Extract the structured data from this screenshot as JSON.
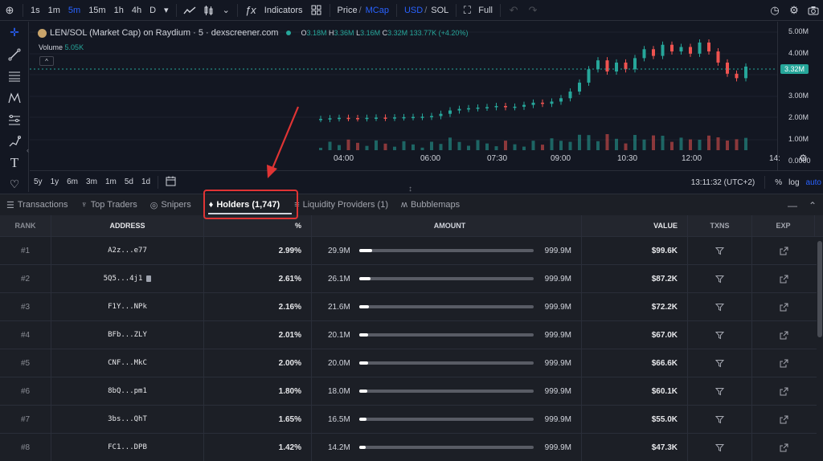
{
  "toolbar": {
    "intervals": [
      "1s",
      "1m",
      "5m",
      "15m",
      "1h",
      "4h",
      "D"
    ],
    "active_interval": "5m",
    "indicators_label": "Indicators",
    "price_label": "Price",
    "mcap_label": "MCap",
    "usd_label": "USD",
    "sol_label": "SOL",
    "full_label": "Full"
  },
  "chart": {
    "title": "LEN/SOL (Market Cap) on Raydium · 5 · dexscreener.com",
    "ohlc": {
      "o_label": "O",
      "o": "3.18M",
      "h_label": "H",
      "h": "3.36M",
      "l_label": "L",
      "l": "3.16M",
      "c_label": "C",
      "c": "3.32M",
      "change": "133.77K (+4.20%)"
    },
    "volume_label": "Volume",
    "volume_value": "5.05K",
    "y_ticks": [
      "5.00M",
      "4.00M",
      "3.00M",
      "2.00M",
      "1.00M",
      "0.0000"
    ],
    "current_price": "3.32M",
    "x_ticks": [
      "04:00",
      "06:00",
      "07:30",
      "09:00",
      "10:30",
      "12:00",
      "14:"
    ],
    "ranges": [
      "5y",
      "1y",
      "6m",
      "3m",
      "1m",
      "5d",
      "1d"
    ],
    "clock": "13:11:32 (UTC+2)",
    "pct_label": "%",
    "log_label": "log",
    "auto_label": "auto",
    "colors": {
      "up": "#26a69a",
      "down": "#ef5350",
      "accent": "#2962ff"
    }
  },
  "chart_data": {
    "type": "candlestick",
    "title": "LEN/SOL (Market Cap) on Raydium · 5 · dexscreener.com",
    "x_ticks": [
      "04:00",
      "06:00",
      "07:30",
      "09:00",
      "10:30",
      "12:00",
      "14:"
    ],
    "y_ticks": [
      "5.00M",
      "4.00M",
      "3.00M",
      "2.00M",
      "1.00M",
      "0.0000"
    ],
    "ylim": [
      0,
      5000000
    ],
    "close_series_approx": [
      [
        0.14,
        0.97
      ],
      [
        0.16,
        1.0
      ],
      [
        0.18,
        1.02
      ],
      [
        0.2,
        1.01
      ],
      [
        0.22,
        1.0
      ],
      [
        0.24,
        1.02
      ],
      [
        0.26,
        1.03
      ],
      [
        0.28,
        1.02
      ],
      [
        0.3,
        1.04
      ],
      [
        0.32,
        1.05
      ],
      [
        0.34,
        1.06
      ],
      [
        0.36,
        1.07
      ],
      [
        0.38,
        1.1
      ],
      [
        0.4,
        1.2
      ],
      [
        0.42,
        1.35
      ],
      [
        0.44,
        1.42
      ],
      [
        0.46,
        1.45
      ],
      [
        0.48,
        1.48
      ],
      [
        0.5,
        1.5
      ],
      [
        0.52,
        1.55
      ],
      [
        0.54,
        1.5
      ],
      [
        0.56,
        1.52
      ],
      [
        0.58,
        1.6
      ],
      [
        0.6,
        1.7
      ],
      [
        0.62,
        1.65
      ],
      [
        0.64,
        1.75
      ],
      [
        0.66,
        1.9
      ],
      [
        0.68,
        2.2
      ],
      [
        0.7,
        2.6
      ],
      [
        0.72,
        3.2
      ],
      [
        0.74,
        3.6
      ],
      [
        0.76,
        3.1
      ],
      [
        0.78,
        3.5
      ],
      [
        0.8,
        3.2
      ],
      [
        0.82,
        3.7
      ],
      [
        0.84,
        4.1
      ],
      [
        0.86,
        3.8
      ],
      [
        0.88,
        4.3
      ],
      [
        0.9,
        4.0
      ],
      [
        0.92,
        4.2
      ],
      [
        0.94,
        3.9
      ],
      [
        0.96,
        4.4
      ],
      [
        0.98,
        4.0
      ],
      [
        1.0,
        3.5
      ],
      [
        1.02,
        3.0
      ],
      [
        1.04,
        2.8
      ],
      [
        1.06,
        3.32
      ]
    ]
  },
  "tabs": {
    "items": [
      {
        "label": "Transactions",
        "icon": "list-icon"
      },
      {
        "label": "Top Traders",
        "icon": "trophy-icon"
      },
      {
        "label": "Snipers",
        "icon": "target-icon"
      },
      {
        "label": "Holders (1,747)",
        "icon": "diamond-icon"
      },
      {
        "label": "Liquidity Providers (1)",
        "icon": "bars-icon"
      },
      {
        "label": "Bubblemaps",
        "icon": "bubblemaps-icon"
      }
    ],
    "active": "Holders (1,747)"
  },
  "table": {
    "headers": {
      "rank": "RANK",
      "address": "ADDRESS",
      "pct": "%",
      "amount": "AMOUNT",
      "value": "VALUE",
      "txns": "TXNS",
      "exp": "EXP"
    },
    "rows": [
      {
        "rank": "#1",
        "address": "A2z...e77",
        "pct": "2.99%",
        "amount": "29.9M",
        "total": "999.9M",
        "fill": 0.03,
        "value": "$99.6K",
        "note": ""
      },
      {
        "rank": "#2",
        "address": "5Q5...4j1",
        "pct": "2.61%",
        "amount": "26.1M",
        "total": "999.9M",
        "fill": 0.026,
        "value": "$87.2K",
        "note": "badge"
      },
      {
        "rank": "#3",
        "address": "F1Y...NPk",
        "pct": "2.16%",
        "amount": "21.6M",
        "total": "999.9M",
        "fill": 0.022,
        "value": "$72.2K",
        "note": ""
      },
      {
        "rank": "#4",
        "address": "BFb...ZLY",
        "pct": "2.01%",
        "amount": "20.1M",
        "total": "999.9M",
        "fill": 0.02,
        "value": "$67.0K",
        "note": ""
      },
      {
        "rank": "#5",
        "address": "CNF...MkC",
        "pct": "2.00%",
        "amount": "20.0M",
        "total": "999.9M",
        "fill": 0.02,
        "value": "$66.6K",
        "note": ""
      },
      {
        "rank": "#6",
        "address": "8bQ...pm1",
        "pct": "1.80%",
        "amount": "18.0M",
        "total": "999.9M",
        "fill": 0.018,
        "value": "$60.1K",
        "note": ""
      },
      {
        "rank": "#7",
        "address": "3bs...QhT",
        "pct": "1.65%",
        "amount": "16.5M",
        "total": "999.9M",
        "fill": 0.017,
        "value": "$55.0K",
        "note": ""
      },
      {
        "rank": "#8",
        "address": "FC1...DPB",
        "pct": "1.42%",
        "amount": "14.2M",
        "total": "999.9M",
        "fill": 0.014,
        "value": "$47.3K",
        "note": ""
      }
    ]
  }
}
